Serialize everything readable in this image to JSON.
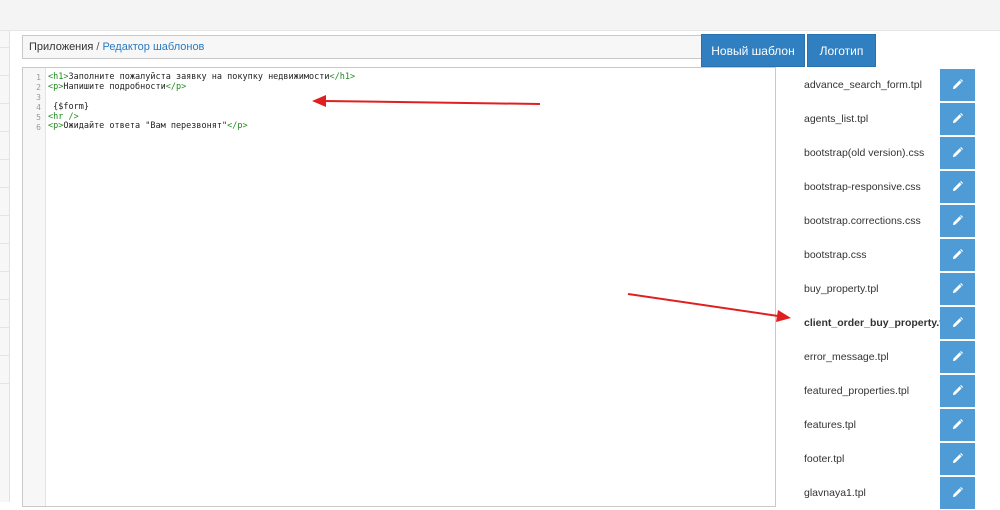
{
  "breadcrumb": {
    "root": "Приложения",
    "separator": "/",
    "current": "Редактор шаблонов"
  },
  "buttons": {
    "new_template": "Новый шаблон",
    "logo": "Логотип"
  },
  "editor": {
    "line_numbers": [
      "1",
      "2",
      "3",
      "4",
      "5",
      "6"
    ],
    "lines": [
      {
        "open": "<h1>",
        "text": "Заполните пожалуйста заявку на покупку недвижимости",
        "close": "</h1>"
      },
      {
        "open": "<p>",
        "text": "Напишите подробности",
        "close": "</p>"
      },
      {
        "open": "",
        "text": "",
        "close": ""
      },
      {
        "open": "",
        "text": " {$form}",
        "close": ""
      },
      {
        "open": "<hr />",
        "text": "",
        "close": ""
      },
      {
        "open": "<p>",
        "text": "Ожидайте ответа \"Вам перезвонят\"",
        "close": "</p>"
      }
    ]
  },
  "files": [
    {
      "name": "advance_search_form.tpl",
      "active": false
    },
    {
      "name": "agents_list.tpl",
      "active": false
    },
    {
      "name": "bootstrap(old version).css",
      "active": false
    },
    {
      "name": "bootstrap-responsive.css",
      "active": false
    },
    {
      "name": "bootstrap.corrections.css",
      "active": false
    },
    {
      "name": "bootstrap.css",
      "active": false
    },
    {
      "name": "buy_property.tpl",
      "active": false
    },
    {
      "name": "client_order_buy_property.tpl",
      "active": true
    },
    {
      "name": "error_message.tpl",
      "active": false
    },
    {
      "name": "featured_properties.tpl",
      "active": false
    },
    {
      "name": "features.tpl",
      "active": false
    },
    {
      "name": "footer.tpl",
      "active": false
    },
    {
      "name": "glavnaya1.tpl",
      "active": false
    }
  ],
  "icons": {
    "file_edit": "pencil-icon"
  },
  "colors": {
    "primary_button": "#2f7fc1",
    "edit_button": "#4e9bd6",
    "link": "#2a7bbf",
    "code_tag": "#1e8a1e",
    "annotation_arrow": "#e02020"
  }
}
